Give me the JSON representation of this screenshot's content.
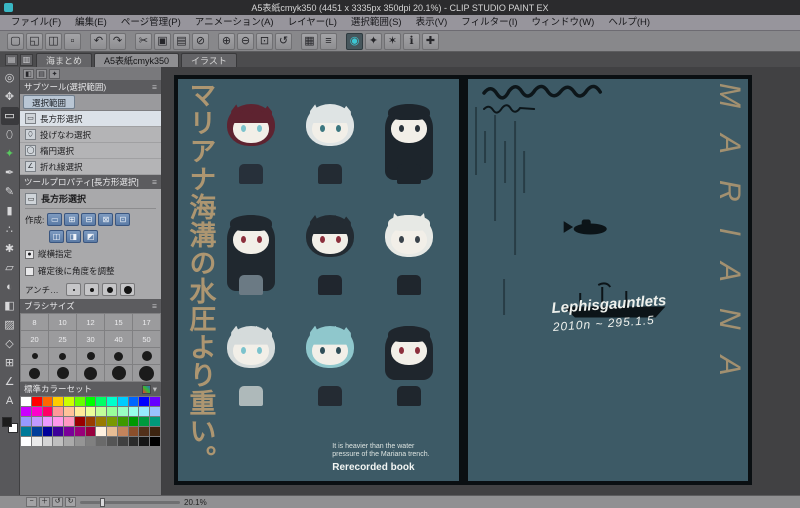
{
  "window": {
    "title": "A5表紙cmyk350 (4451 x 3335px 350dpi 20.1%)  - CLIP STUDIO PAINT EX"
  },
  "menubar": {
    "items": [
      "ファイル(F)",
      "編集(E)",
      "ページ管理(P)",
      "アニメーション(A)",
      "レイヤー(L)",
      "選択範囲(S)",
      "表示(V)",
      "フィルター(I)",
      "ウィンドウ(W)",
      "ヘルプ(H)"
    ]
  },
  "toolbar": {
    "icons": [
      {
        "g": "▢",
        "name": "new-file-icon",
        "cls": "tbtn"
      },
      {
        "g": "◱",
        "name": "open-file-icon",
        "cls": "tbtn"
      },
      {
        "g": "◫",
        "name": "save-icon",
        "cls": "tbtn"
      },
      {
        "g": "▫",
        "name": "export-icon",
        "cls": "tbtn"
      },
      {
        "g": "↶",
        "name": "undo-icon",
        "cls": "tbtn gap"
      },
      {
        "g": "↷",
        "name": "redo-icon",
        "cls": "tbtn"
      },
      {
        "g": "✂",
        "name": "cut-icon",
        "cls": "tbtn gap"
      },
      {
        "g": "▣",
        "name": "copy-icon",
        "cls": "tbtn"
      },
      {
        "g": "▤",
        "name": "paste-icon",
        "cls": "tbtn"
      },
      {
        "g": "⊘",
        "name": "delete-icon",
        "cls": "tbtn"
      },
      {
        "g": "⊕",
        "name": "zoom-in-icon",
        "cls": "tbtn gap"
      },
      {
        "g": "⊖",
        "name": "zoom-out-icon",
        "cls": "tbtn"
      },
      {
        "g": "⊡",
        "name": "fit-view-icon",
        "cls": "tbtn"
      },
      {
        "g": "↺",
        "name": "rotate-view-icon",
        "cls": "tbtn"
      },
      {
        "g": "▦",
        "name": "grid-icon",
        "cls": "tbtn gap"
      },
      {
        "g": "≡",
        "name": "ruler-icon",
        "cls": "tbtn"
      },
      {
        "g": "◉",
        "name": "clip-studio-paint-icon",
        "cls": "tbtn teal gap"
      },
      {
        "g": "✦",
        "name": "material-icon",
        "cls": "tbtn"
      },
      {
        "g": "✶",
        "name": "ask-academy-icon",
        "cls": "tbtn"
      },
      {
        "g": "ℹ",
        "name": "info-icon",
        "cls": "tbtn"
      },
      {
        "g": "✚",
        "name": "add-icon",
        "cls": "tbtn"
      }
    ]
  },
  "tabbar": {
    "icons": [
      {
        "g": "▤",
        "name": "page-manager-icon"
      },
      {
        "g": "▥",
        "name": "story-editor-icon"
      }
    ],
    "tabs": [
      {
        "label": "海まとめ",
        "cls": "doc-tab",
        "name": "tab-umi-matome"
      },
      {
        "label": "A5表紙cmyk350",
        "cls": "doc-tab active",
        "name": "tab-a5-hyoshi-cmyk350"
      },
      {
        "label": "イラスト",
        "cls": "doc-tab",
        "name": "tab-illust"
      }
    ]
  },
  "toolstrip": {
    "tools": [
      {
        "g": "◎",
        "name": "zoom-tool-icon",
        "cls": "tool"
      },
      {
        "g": "✥",
        "name": "move-tool-icon",
        "cls": "tool"
      },
      {
        "g": "▭",
        "name": "selection-tool-icon",
        "cls": "tool sel"
      },
      {
        "g": "⬯",
        "name": "lasso-tool-icon",
        "cls": "tool"
      },
      {
        "g": "✦",
        "name": "auto-select-tool-icon",
        "cls": "tool green"
      },
      {
        "g": "✒",
        "name": "pen-tool-icon",
        "cls": "tool"
      },
      {
        "g": "✎",
        "name": "pencil-tool-icon",
        "cls": "tool"
      },
      {
        "g": "▮",
        "name": "brush-tool-icon",
        "cls": "tool"
      },
      {
        "g": "∴",
        "name": "airbrush-tool-icon",
        "cls": "tool"
      },
      {
        "g": "✱",
        "name": "decoration-tool-icon",
        "cls": "tool"
      },
      {
        "g": "▱",
        "name": "eraser-tool-icon",
        "cls": "tool"
      },
      {
        "g": "◐",
        "name": "blend-tool-icon",
        "cls": "tool"
      },
      {
        "g": "◧",
        "name": "fill-tool-icon",
        "cls": "tool"
      },
      {
        "g": "▨",
        "name": "gradient-tool-icon",
        "cls": "tool"
      },
      {
        "g": "◇",
        "name": "figure-tool-icon",
        "cls": "tool"
      },
      {
        "g": "⊞",
        "name": "frame-tool-icon",
        "cls": "tool"
      },
      {
        "g": "∠",
        "name": "ruler-tool-icon",
        "cls": "tool"
      },
      {
        "g": "A",
        "name": "text-tool-icon",
        "cls": "tool"
      }
    ],
    "fg_style": "background:#1c1c1c",
    "bg_style": "background:#ffffff"
  },
  "dock_icons": [
    {
      "g": "◧",
      "name": "dock-tab-icon-subtool"
    },
    {
      "g": "▤",
      "name": "dock-tab-icon-property"
    },
    {
      "g": "✦",
      "name": "dock-tab-icon-brush"
    }
  ],
  "subtool": {
    "title": "サブツール(選択範囲)",
    "group_tab": "選択範囲",
    "rows": [
      {
        "icon": "▭",
        "label": "長方形選択",
        "cls": "srow sel",
        "name": "subtool-rectangle-select"
      },
      {
        "icon": "⬯",
        "label": "投げなわ選択",
        "cls": "srow",
        "name": "subtool-lasso-select"
      },
      {
        "icon": "◯",
        "label": "楕円選択",
        "cls": "srow",
        "name": "subtool-ellipse-select"
      },
      {
        "icon": "∠",
        "label": "折れ線選択",
        "cls": "srow",
        "name": "subtool-polyline-select"
      }
    ]
  },
  "tool_property": {
    "title": "ツールプロパティ[長方形選択]",
    "tool": "長方形選択",
    "create_label": "作成:",
    "mode_row1": [
      {
        "g": "▭",
        "name": "new-selection-mode-icon"
      },
      {
        "g": "⊞",
        "name": "add-selection-mode-icon"
      },
      {
        "g": "⊟",
        "name": "subtract-selection-mode-icon"
      },
      {
        "g": "⊠",
        "name": "intersect-selection-mode-icon"
      },
      {
        "g": "⊡",
        "name": "exclude-selection-mode-icon"
      }
    ],
    "mode_row2": [
      {
        "g": "◫",
        "name": "selection-style-a-icon"
      },
      {
        "g": "◨",
        "name": "selection-style-b-icon"
      },
      {
        "g": "◩",
        "name": "selection-style-c-icon"
      }
    ],
    "checks": [
      {
        "mark": "●",
        "label": "縦横指定",
        "name": "aspect-ratio-radio"
      },
      {
        "mark": "",
        "label": "確定後に角度を調整",
        "name": "adjust-angle-checkbox"
      }
    ],
    "anti_label": "アンチエイリアス"
  },
  "brush": {
    "title": "ブラシサイズ",
    "cells": [
      {
        "t": "8"
      },
      {
        "t": "10"
      },
      {
        "t": "12"
      },
      {
        "t": "15"
      },
      {
        "t": "17"
      },
      {
        "t": "20"
      },
      {
        "t": "25"
      },
      {
        "t": "30"
      },
      {
        "t": "40"
      },
      {
        "t": "50"
      },
      {
        "s": "--d:6px"
      },
      {
        "s": "--d:7px"
      },
      {
        "s": "--d:8px"
      },
      {
        "s": "--d:9px"
      },
      {
        "s": "--d:10px"
      },
      {
        "s": "--d:11px"
      },
      {
        "s": "--d:12px"
      },
      {
        "s": "--d:13px"
      },
      {
        "s": "--d:14px"
      },
      {
        "s": "--d:15px"
      }
    ]
  },
  "colorset": {
    "title": "標準カラーセット",
    "colors": [
      "#ffffff",
      "#ff0000",
      "#ff6600",
      "#ffcc00",
      "#ccff00",
      "#66ff00",
      "#00ff00",
      "#00ff66",
      "#00ffcc",
      "#00ccff",
      "#0066ff",
      "#0000ff",
      "#6600ff",
      "#cc00ff",
      "#ff00cc",
      "#ff0066",
      "#ff9999",
      "#ffc299",
      "#ffeb99",
      "#ebff99",
      "#c2ff99",
      "#99ff99",
      "#99ffc2",
      "#99ffeb",
      "#99ebff",
      "#99c2ff",
      "#9999ff",
      "#c299ff",
      "#eb99ff",
      "#ff99eb",
      "#ff99c2",
      "#990000",
      "#993d00",
      "#997a00",
      "#7a9900",
      "#3d9900",
      "#009900",
      "#00993d",
      "#00997a",
      "#007a99",
      "#003d99",
      "#000099",
      "#3d0099",
      "#7a0099",
      "#99007a",
      "#99003d",
      "#fff1e0",
      "#e8bd94",
      "#c4845c",
      "#8c4f2b",
      "#52301a",
      "#3d2410",
      "#ffffff",
      "#eaeaea",
      "#d5d5d5",
      "#bfbfbf",
      "#aaaaaa",
      "#959595",
      "#808080",
      "#6a6a6a",
      "#555555",
      "#404040",
      "#2a2a2a",
      "#151515",
      "#000000"
    ]
  },
  "canvas": {
    "accent_tan": "#b49a72",
    "page_teal": "#3d5a66",
    "left_page": {
      "vertical_title": "マリアナ海溝の水圧より重い。",
      "caption_line1": "It is heavier than the water",
      "caption_line2": "pressure of the Mariana trench.",
      "caption_line3": "Rerecorded book"
    },
    "right_page": {
      "handwriting_line1": "Lephisgauntlets",
      "handwriting_line2": "2010n ~ 295.1.5",
      "vertical_text": "MARIANA"
    },
    "characters": [
      {
        "name": "character-red-spiky",
        "cls": "chibi spiky",
        "css": "--hair:#5e2330;--eye:#7cc3cd;--body:#27303a"
      },
      {
        "name": "character-white-spiky",
        "cls": "chibi spiky",
        "css": "--hair:#dfe4e4;--eye:#3c7780;--body:#232b33"
      },
      {
        "name": "character-black-long",
        "cls": "chibi long",
        "css": "--hair:#1d252c;--eye:#2a333b;--body:#1d252c"
      },
      {
        "name": "character-black-long-red-eyes",
        "cls": "chibi long",
        "css": "--hair:#20282f;--eye:#8c2f3c;--body:#6b7a84"
      },
      {
        "name": "character-black-messy-red-eyes",
        "cls": "chibi spiky",
        "css": "--hair:#232b32;--eye:#8c2f3c;--body:#20262e"
      },
      {
        "name": "character-white-cat-ears",
        "cls": "chibi cat",
        "css": "--hair:#e7e9e5;--eye:#39424a;--body:#1f262d"
      },
      {
        "name": "character-silver-hair",
        "cls": "chibi spiky",
        "css": "--hair:#d5dbdb;--eye:#7cc3cd;--body:#aeb9ba"
      },
      {
        "name": "character-teal-hair",
        "cls": "chibi spiky",
        "css": "--hair:#8fc7cc;--eye:#2f4e58;--body:#242b33"
      },
      {
        "name": "character-black-bob",
        "cls": "chibi bob",
        "css": "--hair:#1f262d;--eye:#8c2f3c;--body:#1f262d"
      }
    ]
  },
  "statusbar": {
    "zoom": "20.1%",
    "icons": [
      {
        "g": "−",
        "name": "zoom-out-icon"
      },
      {
        "g": "＋",
        "name": "zoom-in-icon"
      },
      {
        "g": "↺",
        "name": "rotate-left-icon"
      },
      {
        "g": "↻",
        "name": "rotate-right-icon"
      }
    ]
  }
}
